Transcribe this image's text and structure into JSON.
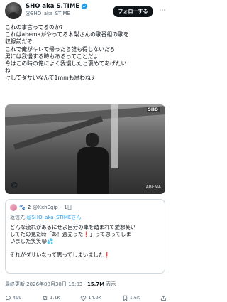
{
  "author": {
    "name": "SHO aka S.TIME",
    "handle": "@SHO_aka_STIME",
    "follow_label": "フォローする",
    "more_label": "⋯"
  },
  "tweet": {
    "lines": [
      "これの事言ってるのか?",
      "これはabemaがやってる木梨さんの歌番組の歌を",
      "収録前だぞ",
      "これで俺がキレて帰ったら誰も得しないだろ",
      "男には我慢する時もあるってことだよ",
      "今はこの時の俺によく我慢したと褒めてあげたい",
      "ね",
      "けしてダサいなんて1mmも思わねぇ"
    ]
  },
  "media": {
    "badge": "SHO",
    "logo": "ABEMA",
    "sticker": "😄"
  },
  "quote": {
    "emoji": "🐾",
    "count": "2",
    "handle": "@XxhEgip",
    "time": "1日",
    "reply_prefix": "返信先:",
    "reply_to": "@SHO_aka_STIMEさん",
    "lines": [
      "どんな流れがあるにせよ自分の車を踏まれて愛想笑い",
      "してたの見た時「あ！週売った❗」って思ってしま",
      "いました笑笑😅💦",
      "",
      "それがダサいなって思ってしまいました❗"
    ]
  },
  "footer": {
    "prefix": "最終更新 2026年08月30日 16:03 · ",
    "views": "15.7M",
    "views_suffix": " 表示"
  },
  "actions": {
    "reply": "499",
    "retweet": "1.1K",
    "like": "14.9K",
    "bookmark": "1.6K"
  }
}
